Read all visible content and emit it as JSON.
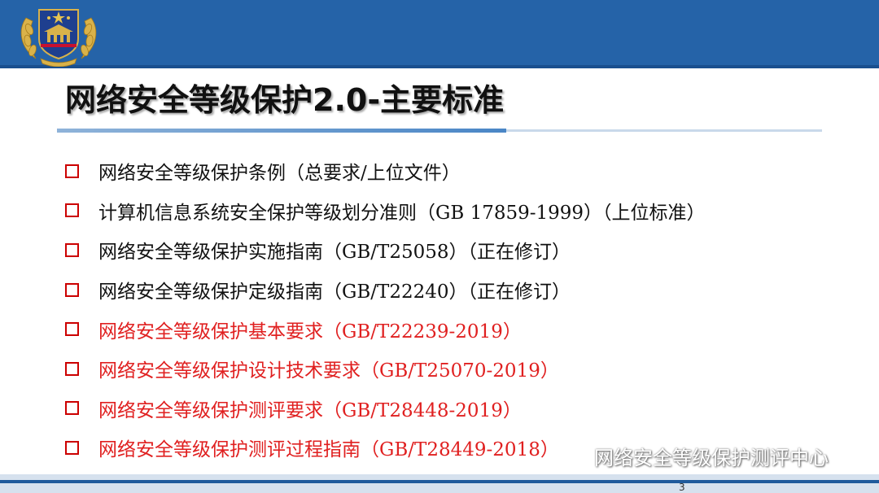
{
  "header": {
    "title": "网络安全等级保护2.0-主要标准",
    "emblem_icon": "police-emblem-icon",
    "bar_color": "#2563a8"
  },
  "list": {
    "bullet_icon": "hollow-square-bullet-icon",
    "bullet_color": "#cc0000",
    "highlight_color": "#e02020",
    "items": [
      {
        "text": "网络安全等级保护条例（总要求/上位文件）",
        "highlight": false
      },
      {
        "text": "计算机信息系统安全保护等级划分准则（GB 17859-1999）（上位标准）",
        "highlight": false
      },
      {
        "text": "网络安全等级保护实施指南（GB/T25058）（正在修订）",
        "highlight": false
      },
      {
        "text": "网络安全等级保护定级指南（GB/T22240）（正在修订）",
        "highlight": false
      },
      {
        "text": "网络安全等级保护基本要求（GB/T22239-2019）",
        "highlight": true
      },
      {
        "text": "网络安全等级保护设计技术要求（GB/T25070-2019）",
        "highlight": true
      },
      {
        "text": "网络安全等级保护测评要求（GB/T28448-2019）",
        "highlight": true
      },
      {
        "text": "网络安全等级保护测评过程指南（GB/T28449-2018）",
        "highlight": true
      }
    ]
  },
  "watermark": {
    "icon": "wechat-icon",
    "text": "网络安全等级保护测评中心"
  },
  "footer": {
    "page_number": "3"
  }
}
